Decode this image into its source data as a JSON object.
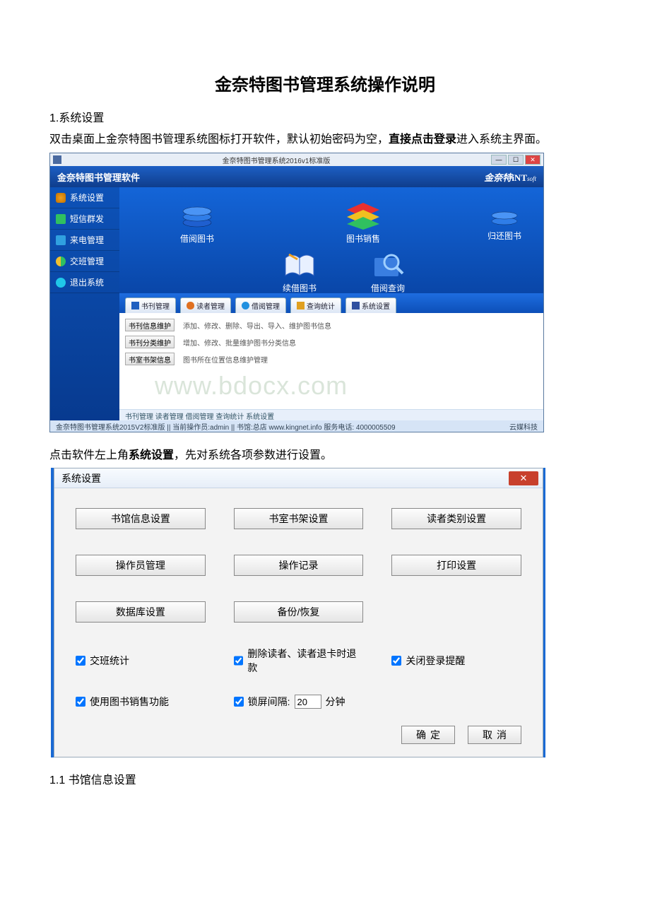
{
  "doc": {
    "title": "金奈特图书管理系统操作说明",
    "h1": "1.系统设置",
    "p1a": "双击桌面上金奈特图书管理系统图标打开软件，默认初始密码为空，",
    "p1b": "直接点击登录",
    "p1c": "进入系统主界面。",
    "p2a": "点击软件左上角",
    "p2b": "系统设置",
    "p2c": "，先对系统各项参数进行设置。",
    "h11": "1.1 书馆信息设置"
  },
  "app": {
    "titlebar": "金奈特图书管理系统2016v1标准版",
    "win_min": "—",
    "win_max": "☐",
    "win_close": "✕",
    "header_left": "金奈特图书管理软件",
    "header_right_a": "金奈特",
    "header_right_b": "iNT",
    "header_right_c": "soft",
    "sidebar": [
      {
        "label": "系统设置",
        "color": "#f0a020"
      },
      {
        "label": "短信群发",
        "color": "#30c060"
      },
      {
        "label": "来电管理",
        "color": "#30a0e0"
      },
      {
        "label": "交班管理",
        "color": "#f0c030"
      },
      {
        "label": "退出系统",
        "color": "#20c8e8"
      }
    ],
    "bigicons": {
      "borrow": "借阅图书",
      "sale": "图书销售",
      "return": "归还图书",
      "renew": "续借图书",
      "query": "借阅查询"
    },
    "tabs": [
      {
        "label": "书刊管理",
        "color": "#2060c0"
      },
      {
        "label": "读者管理",
        "color": "#e07020"
      },
      {
        "label": "借阅管理",
        "color": "#2090e0"
      },
      {
        "label": "查询统计",
        "color": "#e0a020"
      },
      {
        "label": "系统设置",
        "color": "#3050a0"
      }
    ],
    "tabcontent": [
      {
        "btn": "书刊信息维护",
        "desc": "添加、修改、删除、导出、导入、维护图书信息"
      },
      {
        "btn": "书刊分类维护",
        "desc": "增加、修改、批量维护图书分类信息"
      },
      {
        "btn": "书室书架信息",
        "desc": "图书所在位置信息维护管理"
      }
    ],
    "watermark": "www.bdocx.com",
    "breadcrumb": "书刊管理    读者管理    借阅管理    查询统计    系统设置",
    "status_left": "金奈特图书管理系统2015V2标准版   ||  当前操作员:admin   ||   书馆:总店        www.kingnet.info        服务电话: 4000005509",
    "status_right": "云媒科技"
  },
  "dialog": {
    "title": "系统设置",
    "close": "✕",
    "buttons": [
      "书馆信息设置",
      "书室书架设置",
      "读者类别设置",
      "操作员管理",
      "操作记录",
      "打印设置",
      "数据库设置",
      "备份/恢复",
      ""
    ],
    "opts": {
      "opt1": "交班统计",
      "opt2": "删除读者、读者退卡时退款",
      "opt3": "关闭登录提醒",
      "opt4": "使用图书销售功能",
      "opt5a": "锁屏间隔:",
      "opt5_value": "20",
      "opt5b": "分钟"
    },
    "ok": "确定",
    "cancel": "取消"
  }
}
